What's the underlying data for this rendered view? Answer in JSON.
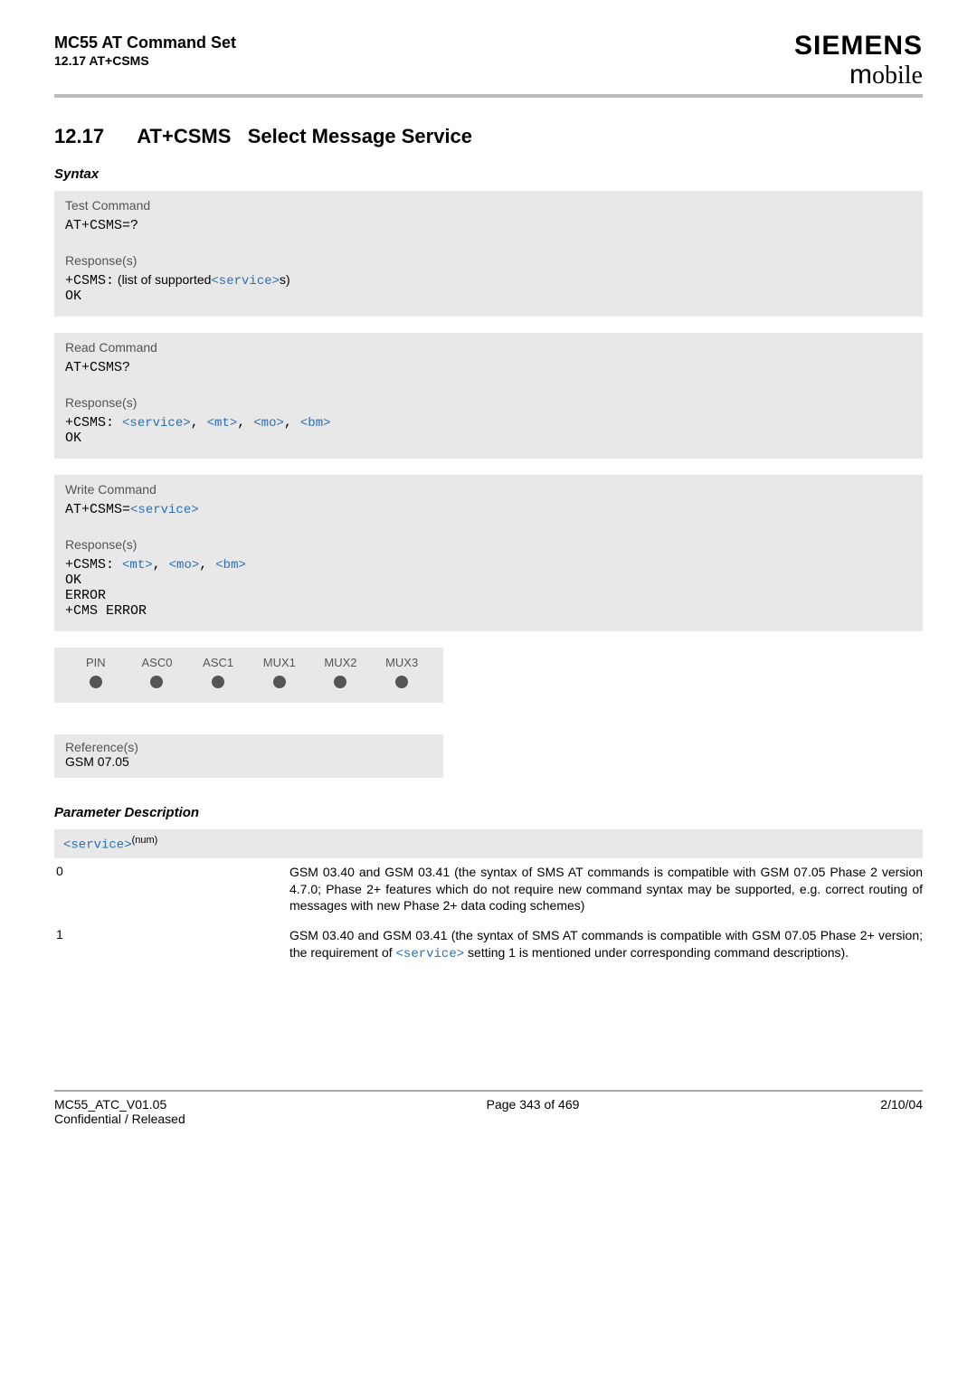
{
  "header": {
    "doc_title": "MC55 AT Command Set",
    "section_ref": "12.17 AT+CSMS",
    "brand_top": "SIEMENS",
    "brand_bottom_m": "m",
    "brand_bottom_rest": "obile"
  },
  "title": {
    "num": "12.17",
    "cmd": "AT+CSMS",
    "rest": "Select Message Service"
  },
  "syntax_label": "Syntax",
  "blocks": {
    "test": {
      "head": "Test Command",
      "cmd": "AT+CSMS=?",
      "resp_label": "Response(s)",
      "resp_prefix": "+CSMS:",
      "resp_text_a": " (list of supported",
      "resp_param": "<service>",
      "resp_text_b": "s)",
      "ok": "OK"
    },
    "read": {
      "head": "Read Command",
      "cmd": "AT+CSMS?",
      "resp_label": "Response(s)",
      "resp_prefix": "+CSMS: ",
      "p1": "<service>",
      "c1": ", ",
      "p2": "<mt>",
      "c2": ", ",
      "p3": "<mo>",
      "c3": ", ",
      "p4": "<bm>",
      "ok": "OK"
    },
    "write": {
      "head": "Write Command",
      "cmd_prefix": "AT+CSMS=",
      "cmd_param": "<service>",
      "resp_label": "Response(s)",
      "resp_prefix": "+CSMS: ",
      "p1": "<mt>",
      "c1": ", ",
      "p2": "<mo>",
      "c2": ", ",
      "p3": "<bm>",
      "ok": "OK",
      "error": "ERROR",
      "cms": "+CMS ERROR"
    }
  },
  "channels": {
    "cols": [
      "PIN",
      "ASC0",
      "ASC1",
      "MUX1",
      "MUX2",
      "MUX3"
    ]
  },
  "reference": {
    "label": "Reference(s)",
    "value": "GSM 07.05"
  },
  "param_desc_label": "Parameter Description",
  "param_service": {
    "name": "<service>",
    "num_sup": "(num)"
  },
  "param_rows": [
    {
      "val": "0",
      "desc": "GSM 03.40 and GSM 03.41 (the syntax of SMS AT commands is compatible with GSM 07.05 Phase 2 version 4.7.0; Phase 2+ features which do not require new command syntax may be supported, e.g. correct routing of messages with new Phase 2+ data coding schemes)"
    },
    {
      "val": "1",
      "desc_a": "GSM 03.40 and GSM 03.41 (the syntax of SMS AT commands is compatible with GSM 07.05 Phase 2+ version; the requirement of ",
      "inline_param": "<service>",
      "desc_b": " setting 1 is mentioned under corresponding command descriptions)."
    }
  ],
  "footer": {
    "left_a": "MC55_ATC_V01.05",
    "left_b": "Confidential / Released",
    "center": "Page 343 of 469",
    "right": "2/10/04"
  }
}
